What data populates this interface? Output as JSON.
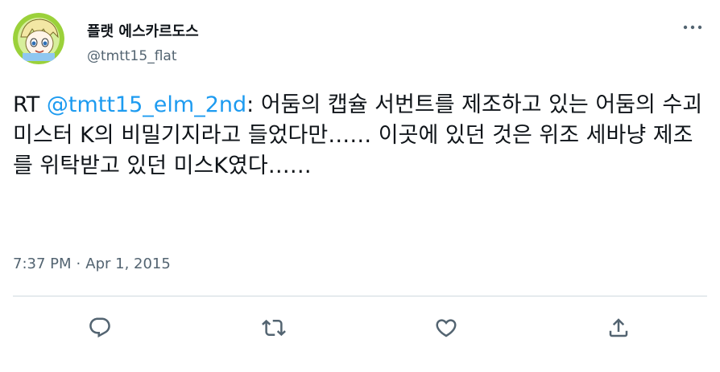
{
  "author": {
    "display_name": "플랫 에스카르도스",
    "handle": "@tmtt15_flat",
    "avatar_icon": "anime-character-avatar"
  },
  "tweet": {
    "prefix": "RT ",
    "mention": "@tmtt15_elm_2nd",
    "body": ": 어둠의 캡슐 서번트를 제조하고 있는 어둠의 수괴 미스터 K의 비밀기지라고 들었다만…… 이곳에 있던 것은 위조 세바냥 제조를 위탁받고 있던 미스K였다……"
  },
  "meta": {
    "time": "7:37 PM",
    "separator": "·",
    "date": "Apr 1, 2015"
  },
  "actions": {
    "reply_icon": "reply-icon",
    "retweet_icon": "retweet-icon",
    "like_icon": "heart-icon",
    "share_icon": "share-icon"
  },
  "colors": {
    "accent": "#1d9bf0",
    "secondary_text": "#536471",
    "primary_text": "#0f1419",
    "divider": "#cfd9de"
  }
}
